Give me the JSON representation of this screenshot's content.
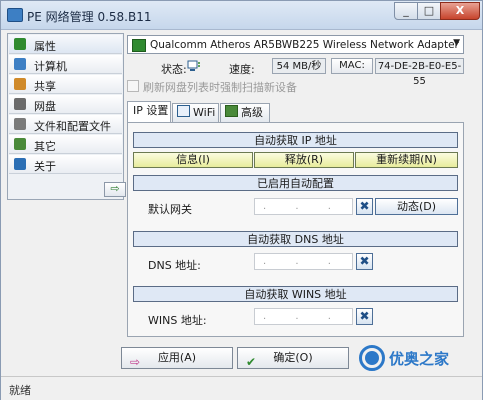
{
  "window": {
    "title": "PE 网络管理 0.58.B11",
    "minimize": "_",
    "maximize": "□",
    "close": "X"
  },
  "sidebar": {
    "items": [
      {
        "label": "属性",
        "icon": "properties-icon",
        "color": "#2f8a2f"
      },
      {
        "label": "计算机",
        "icon": "computer-icon",
        "color": "#3d7fc4"
      },
      {
        "label": "共享",
        "icon": "share-icon",
        "color": "#d08a2a"
      },
      {
        "label": "网盘",
        "icon": "network-drive-icon",
        "color": "#6b6b6b"
      },
      {
        "label": "文件和配置文件",
        "icon": "file-config-icon",
        "color": "#7a7a7a"
      },
      {
        "label": "其它",
        "icon": "other-icon",
        "color": "#4a8a3a"
      },
      {
        "label": "关于",
        "icon": "about-icon",
        "color": "#2c6fb5"
      }
    ],
    "toggle_arrow": "⇨"
  },
  "adapter": {
    "selected": "Qualcomm Atheros AR5BWB225 Wireless Network Adapter"
  },
  "status": {
    "status_label": "状态:",
    "speed_label": "速度:",
    "speed_value": "54 MB/秒",
    "mac_label": "MAC:",
    "mac_value": "74-DE-2B-E0-E5-55"
  },
  "refresh_option": {
    "label": "刷新网盘列表时强制扫描新设备",
    "checked": false,
    "enabled": false
  },
  "tabs": [
    {
      "label": "IP 设置",
      "active": true
    },
    {
      "label": "WiFi",
      "active": false
    },
    {
      "label": "高级",
      "active": false
    }
  ],
  "ip_section": {
    "auto_ip_label": "自动获取 IP 地址",
    "info_label": "信息(I)",
    "release_label": "释放(R)",
    "renew_label": "重新续期(N)",
    "autoconfig_label": "已启用自动配置",
    "gateway_label": "默认网关",
    "gateway_value": ". . .",
    "dynamic_label": "动态(D)",
    "auto_dns_label": "自动获取 DNS 地址",
    "dns_label": "DNS 地址:",
    "dns_value": ". . .",
    "auto_wins_label": "自动获取 WINS 地址",
    "wins_label": "WINS 地址:",
    "wins_value": ". . ."
  },
  "buttons": {
    "apply": "应用(A)",
    "ok": "确定(O)",
    "apply_icon": "⇨",
    "ok_icon": "✔"
  },
  "logo": {
    "text": "优奥之家"
  },
  "statusbar": {
    "text": "就绪"
  }
}
